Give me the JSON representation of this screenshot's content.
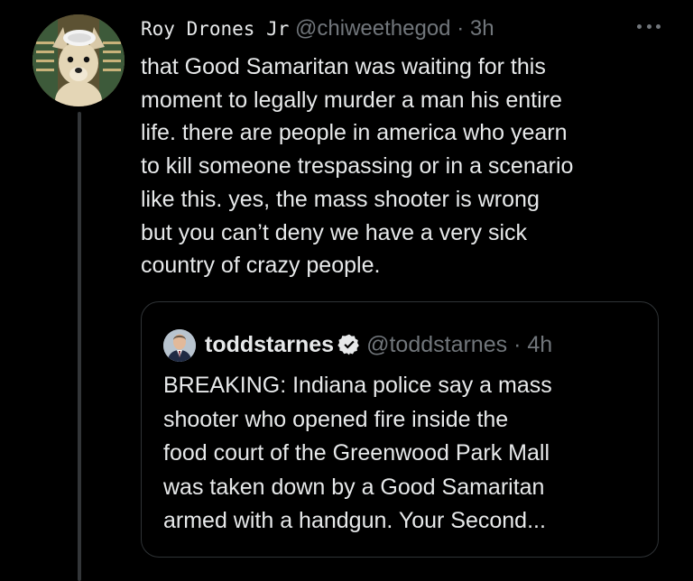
{
  "tweet": {
    "author_name": "Roy Drones Jr",
    "handle": "@chiweethegod",
    "separator": "·",
    "time": "3h",
    "more_icon": "more-horizontal-icon",
    "text_lines": [
      "that Good Samaritan was waiting for this",
      "moment to legally murder a man his entire",
      "life. there are people in america who yearn",
      "to kill someone trespassing or in a scenario",
      "like this. yes, the mass shooter is wrong",
      "but you can’t deny we have a very sick",
      "country of crazy people."
    ]
  },
  "quoted_tweet": {
    "author_name": "toddstarnes",
    "verified_icon": "verified-badge-icon",
    "handle": "@toddstarnes",
    "separator": "·",
    "time": "4h",
    "text_lines": [
      "BREAKING: Indiana police say a mass",
      "shooter who opened fire inside the",
      "food court of the Greenwood Park Mall",
      "was taken down by a Good Samaritan",
      "armed with a handgun. Your Second..."
    ]
  },
  "colors": {
    "background": "#000000",
    "text_primary": "#e7e9ea",
    "text_secondary": "#71767b",
    "border": "#2f3336",
    "verified_badge": "#e7e9ea"
  }
}
